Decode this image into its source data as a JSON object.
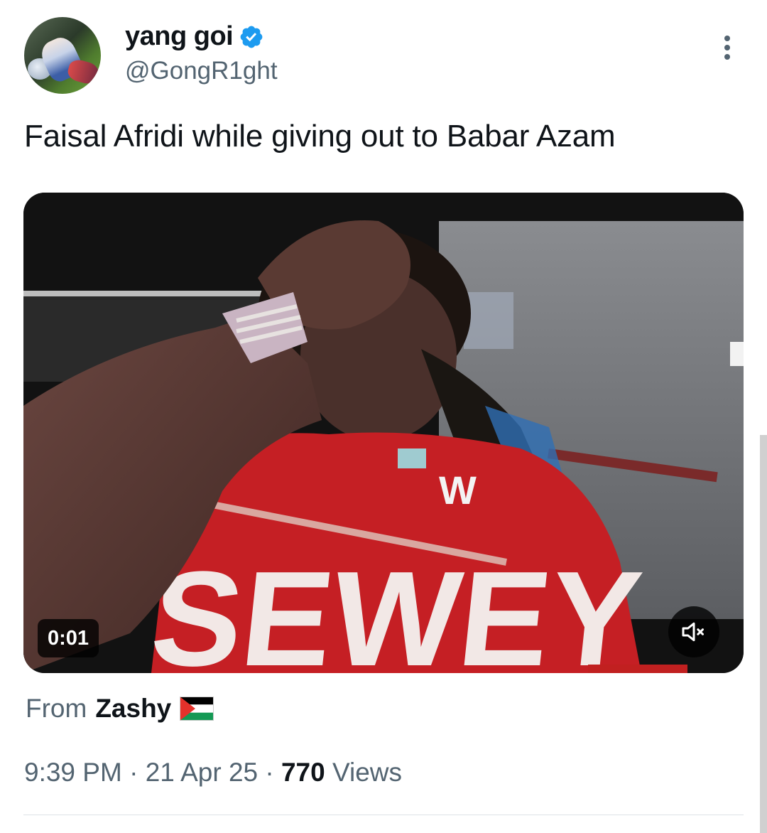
{
  "author": {
    "display_name": "yang goi",
    "handle": "@GongR1ght",
    "verified_color": "#1d9bf0"
  },
  "tweet": {
    "text": "Faisal Afridi while giving out to Babar Azam"
  },
  "media": {
    "time": "0:01",
    "muted": true,
    "shirt_text": "SEWEY"
  },
  "source": {
    "prefix": "From",
    "account": "Zashy",
    "flag_icon": "palestine-flag-icon"
  },
  "meta": {
    "time": "9:39 PM",
    "separator": "·",
    "date": "21 Apr 25",
    "views_count": "770",
    "views_label": "Views"
  },
  "icons": {
    "more": "more-vertical-icon",
    "mute": "volume-muted-icon",
    "verified": "verified-badge-icon"
  }
}
